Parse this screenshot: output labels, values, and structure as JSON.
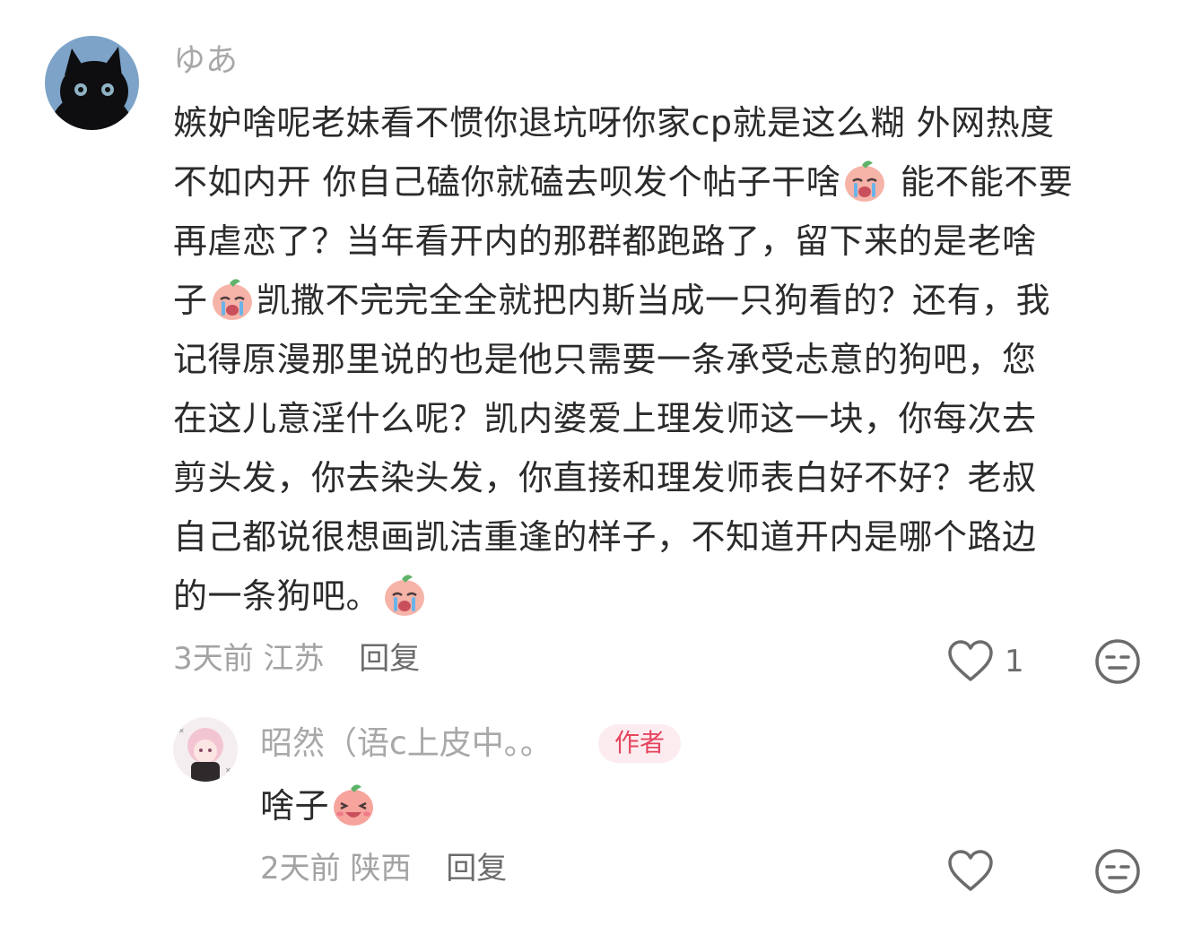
{
  "comments": [
    {
      "username": "ゆあ",
      "lines": [
        "嫉妒啥呢老妹看不惯你退坑呀你家cp就是这么糊 外网热度",
        "不如内开 你自己磕你就磕去呗发个帖子干啥",
        "能不能不要",
        "再虐恋了？当年看开内的那群都跑路了，留下来的是老啥",
        "子",
        "凯撒不完完全全就把内斯当成一只狗看的？还有，我",
        "记得原漫那里说的也是他只需要一条承受忐意的狗吧，您",
        "在这儿意淫什么呢？凯内婆爱上理发师这一块，你每次去",
        "剪头发，你去染头发，你直接和理发师表白好不好？老叔",
        "自己都说很想画凯洁重逢的样子，不知道开内是哪个路边",
        "的一条狗吧。"
      ],
      "time": "3天前",
      "location": "江苏",
      "reply_label": "回复",
      "like_count": "1",
      "emoji_name": "crying-peach-emoji"
    },
    {
      "username": "昭然（语c上皮中。。",
      "badge": "作者",
      "text": "啥子",
      "time": "2天前",
      "location": "陕西",
      "reply_label": "回复",
      "emoji_name": "laughing-peach-emoji"
    }
  ],
  "colors": {
    "username": "#a8a8a8",
    "text": "#2b2b2b",
    "meta": "#a3a3a3",
    "badge_bg": "#fdecef",
    "badge_text": "#e5455f"
  }
}
